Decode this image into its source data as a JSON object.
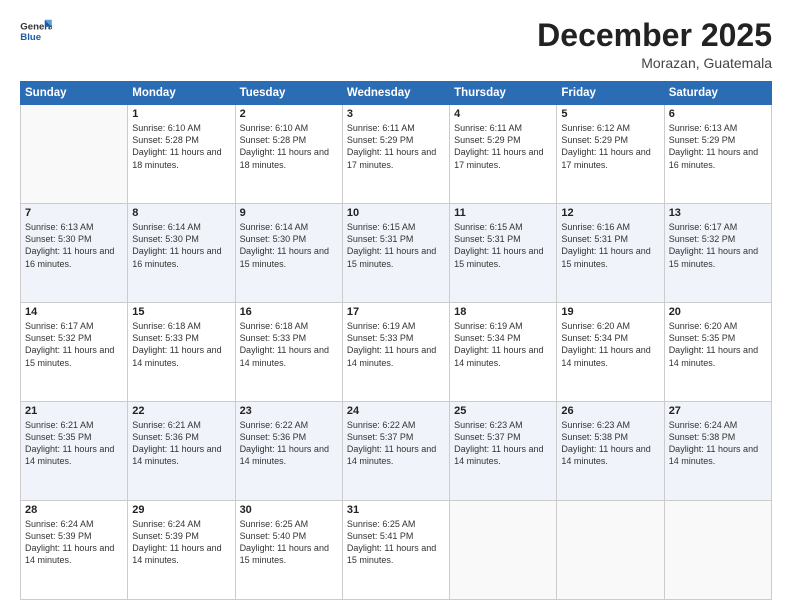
{
  "header": {
    "logo_line1": "General",
    "logo_line2": "Blue",
    "month": "December 2025",
    "location": "Morazan, Guatemala"
  },
  "days_of_week": [
    "Sunday",
    "Monday",
    "Tuesday",
    "Wednesday",
    "Thursday",
    "Friday",
    "Saturday"
  ],
  "weeks": [
    [
      {
        "num": "",
        "sunrise": "",
        "sunset": "",
        "daylight": ""
      },
      {
        "num": "1",
        "sunrise": "6:10 AM",
        "sunset": "5:28 PM",
        "daylight": "11 hours and 18 minutes."
      },
      {
        "num": "2",
        "sunrise": "6:10 AM",
        "sunset": "5:28 PM",
        "daylight": "11 hours and 18 minutes."
      },
      {
        "num": "3",
        "sunrise": "6:11 AM",
        "sunset": "5:29 PM",
        "daylight": "11 hours and 17 minutes."
      },
      {
        "num": "4",
        "sunrise": "6:11 AM",
        "sunset": "5:29 PM",
        "daylight": "11 hours and 17 minutes."
      },
      {
        "num": "5",
        "sunrise": "6:12 AM",
        "sunset": "5:29 PM",
        "daylight": "11 hours and 17 minutes."
      },
      {
        "num": "6",
        "sunrise": "6:13 AM",
        "sunset": "5:29 PM",
        "daylight": "11 hours and 16 minutes."
      }
    ],
    [
      {
        "num": "7",
        "sunrise": "6:13 AM",
        "sunset": "5:30 PM",
        "daylight": "11 hours and 16 minutes."
      },
      {
        "num": "8",
        "sunrise": "6:14 AM",
        "sunset": "5:30 PM",
        "daylight": "11 hours and 16 minutes."
      },
      {
        "num": "9",
        "sunrise": "6:14 AM",
        "sunset": "5:30 PM",
        "daylight": "11 hours and 15 minutes."
      },
      {
        "num": "10",
        "sunrise": "6:15 AM",
        "sunset": "5:31 PM",
        "daylight": "11 hours and 15 minutes."
      },
      {
        "num": "11",
        "sunrise": "6:15 AM",
        "sunset": "5:31 PM",
        "daylight": "11 hours and 15 minutes."
      },
      {
        "num": "12",
        "sunrise": "6:16 AM",
        "sunset": "5:31 PM",
        "daylight": "11 hours and 15 minutes."
      },
      {
        "num": "13",
        "sunrise": "6:17 AM",
        "sunset": "5:32 PM",
        "daylight": "11 hours and 15 minutes."
      }
    ],
    [
      {
        "num": "14",
        "sunrise": "6:17 AM",
        "sunset": "5:32 PM",
        "daylight": "11 hours and 15 minutes."
      },
      {
        "num": "15",
        "sunrise": "6:18 AM",
        "sunset": "5:33 PM",
        "daylight": "11 hours and 14 minutes."
      },
      {
        "num": "16",
        "sunrise": "6:18 AM",
        "sunset": "5:33 PM",
        "daylight": "11 hours and 14 minutes."
      },
      {
        "num": "17",
        "sunrise": "6:19 AM",
        "sunset": "5:33 PM",
        "daylight": "11 hours and 14 minutes."
      },
      {
        "num": "18",
        "sunrise": "6:19 AM",
        "sunset": "5:34 PM",
        "daylight": "11 hours and 14 minutes."
      },
      {
        "num": "19",
        "sunrise": "6:20 AM",
        "sunset": "5:34 PM",
        "daylight": "11 hours and 14 minutes."
      },
      {
        "num": "20",
        "sunrise": "6:20 AM",
        "sunset": "5:35 PM",
        "daylight": "11 hours and 14 minutes."
      }
    ],
    [
      {
        "num": "21",
        "sunrise": "6:21 AM",
        "sunset": "5:35 PM",
        "daylight": "11 hours and 14 minutes."
      },
      {
        "num": "22",
        "sunrise": "6:21 AM",
        "sunset": "5:36 PM",
        "daylight": "11 hours and 14 minutes."
      },
      {
        "num": "23",
        "sunrise": "6:22 AM",
        "sunset": "5:36 PM",
        "daylight": "11 hours and 14 minutes."
      },
      {
        "num": "24",
        "sunrise": "6:22 AM",
        "sunset": "5:37 PM",
        "daylight": "11 hours and 14 minutes."
      },
      {
        "num": "25",
        "sunrise": "6:23 AM",
        "sunset": "5:37 PM",
        "daylight": "11 hours and 14 minutes."
      },
      {
        "num": "26",
        "sunrise": "6:23 AM",
        "sunset": "5:38 PM",
        "daylight": "11 hours and 14 minutes."
      },
      {
        "num": "27",
        "sunrise": "6:24 AM",
        "sunset": "5:38 PM",
        "daylight": "11 hours and 14 minutes."
      }
    ],
    [
      {
        "num": "28",
        "sunrise": "6:24 AM",
        "sunset": "5:39 PM",
        "daylight": "11 hours and 14 minutes."
      },
      {
        "num": "29",
        "sunrise": "6:24 AM",
        "sunset": "5:39 PM",
        "daylight": "11 hours and 14 minutes."
      },
      {
        "num": "30",
        "sunrise": "6:25 AM",
        "sunset": "5:40 PM",
        "daylight": "11 hours and 15 minutes."
      },
      {
        "num": "31",
        "sunrise": "6:25 AM",
        "sunset": "5:41 PM",
        "daylight": "11 hours and 15 minutes."
      },
      {
        "num": "",
        "sunrise": "",
        "sunset": "",
        "daylight": ""
      },
      {
        "num": "",
        "sunrise": "",
        "sunset": "",
        "daylight": ""
      },
      {
        "num": "",
        "sunrise": "",
        "sunset": "",
        "daylight": ""
      }
    ]
  ]
}
